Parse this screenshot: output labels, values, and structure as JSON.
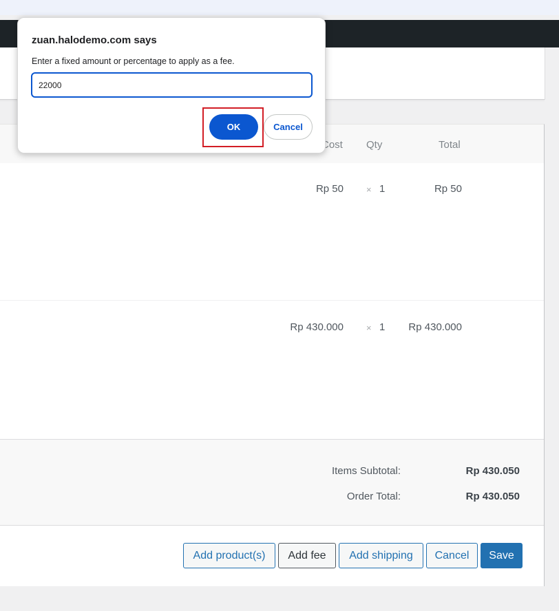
{
  "dialog": {
    "title": "zuan.halodemo.com says",
    "message": "Enter a fixed amount or percentage to apply as a fee.",
    "input_value": "22000",
    "ok_label": "OK",
    "cancel_label": "Cancel"
  },
  "table": {
    "headers": {
      "cost": "Cost",
      "qty": "Qty",
      "total": "Total"
    },
    "rows": [
      {
        "cost": "Rp 50",
        "times": "×",
        "qty": "1",
        "total": "Rp 50"
      },
      {
        "cost": "Rp 430.000",
        "times": "×",
        "qty": "1",
        "total": "Rp 430.000"
      }
    ]
  },
  "totals": {
    "items_subtotal_label": "Items Subtotal:",
    "items_subtotal_value": "Rp 430.050",
    "order_total_label": "Order Total:",
    "order_total_value": "Rp 430.050"
  },
  "actions": {
    "add_products": "Add product(s)",
    "add_fee": "Add fee",
    "add_shipping": "Add shipping",
    "cancel": "Cancel",
    "save": "Save"
  },
  "colors": {
    "primary": "#2271b1",
    "dialog_accent": "#0b57d0",
    "highlight": "#d21d25"
  }
}
